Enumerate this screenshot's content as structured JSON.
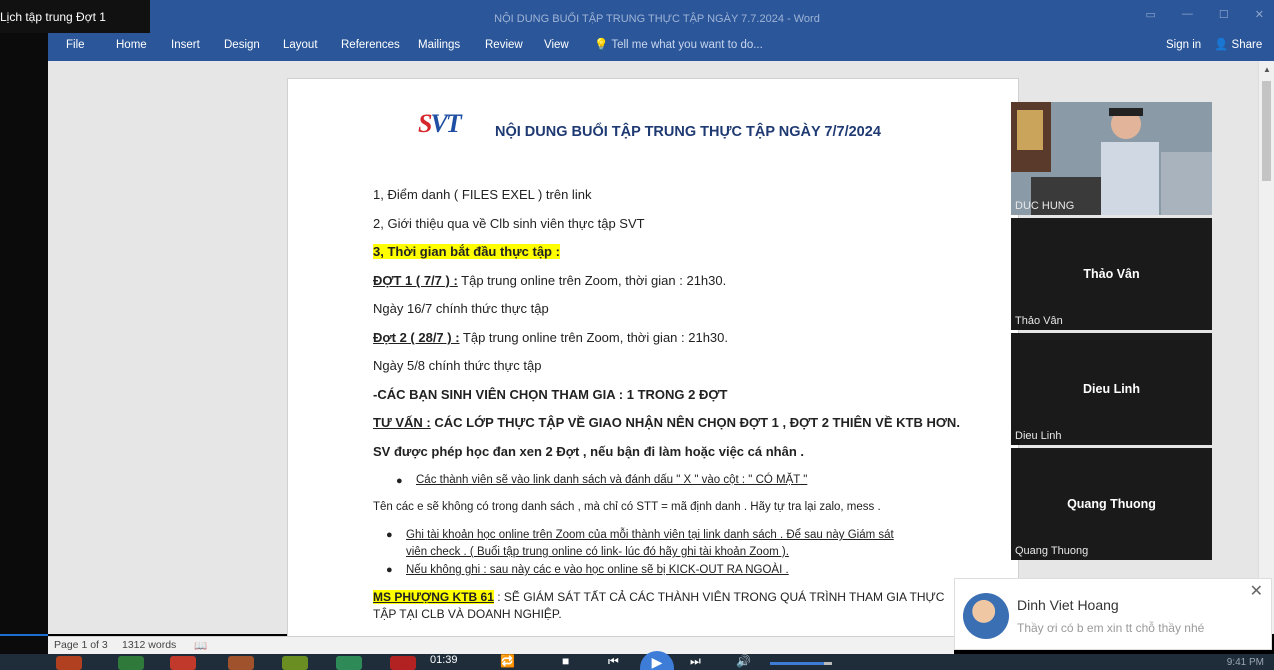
{
  "zoom": {
    "window_title": "Lịch tập trung Đợt 1"
  },
  "word": {
    "window_title": "NỘI DUNG BUỔI  TẬP TRUNG THỰC TẬP NGÀY 7.7.2024 - Word",
    "tabs": [
      "File",
      "Home",
      "Insert",
      "Design",
      "Layout",
      "References",
      "Mailings",
      "Review",
      "View"
    ],
    "tell_me": "Tell me what you want to do...",
    "sign_in": "Sign in",
    "share": "Share"
  },
  "document": {
    "logo": {
      "s": "S",
      "v": "V",
      "t": "T"
    },
    "title": "NỘI DUNG BUỔI  TẬP TRUNG THỰC TẬP NGÀY 7/7/2024",
    "line1": "1, Điểm danh  ( FILES EXEL ) trên link",
    "line2": "2, Giới thiệu qua về Clb sinh viên thực tập SVT",
    "line3": "3, Thời gian bắt đầu thực tập :",
    "dot1_label": "ĐỢT  1  ( 7/7 )   :",
    "dot1_text": " Tập trung online trên Zoom, thời gian : 21h30.",
    "dot1_day": "Ngày  16/7  chính thức thực tập",
    "dot2_label": "Đợt 2   (  28/7 ) :",
    "dot2_text": "  Tập trung online trên Zoom, thời gian : 21h30.",
    "dot2_day": "Ngày  5/8  chính thức thực tập",
    "choose": "-CÁC BẠN SINH VIÊN CHỌN THAM GIA : 1 TRONG 2 ĐỢT",
    "advice_label": "TƯ VẤN :",
    "advice_text": " CÁC LỚP THỰC TẬP VỀ GIAO NHẬN NÊN CHỌN ĐỢT 1 , ĐỢT 2 THIÊN VỀ KTB HƠN.",
    "alternate": "SV được phép học đan xen 2 Đợt , nếu bận đi làm hoặc việc cá nhân .",
    "bullet1": "Các thành viên sẽ vào link danh sách và  đánh dấu \" X \"  vào cột : \" CÓ MẶT \"",
    "not_in_list": "Tên các e sẽ không có  trong danh sách , mà chỉ có STT = mã định danh . Hãy tự tra lại zalo, mess .",
    "bullet2_l1": "Ghi tài khoản học online trên Zoom của mỗi thành viên tại  link danh sách . Để sau này Giám sát",
    "bullet2_l2": "viên check . ( Buổi tập trung online có link- lúc đó hãy ghi tài khoản Zoom ).",
    "bullet3": "Nếu không ghi : sau này các e vào học online sẽ bị   KICK-OUT   RA NGOÀI .",
    "ms_label": "MS  PHƯỢNG  KTB  61",
    "ms_text_l1": " :  SẼ  GIÁM SÁT TẤT CẢ CÁC THÀNH VIÊN TRONG QUÁ TRÌNH THAM GIA THỰC",
    "ms_text_l2": "TẬP TẠI CLB VÀ DOANH NGHIỆP."
  },
  "status_bar": {
    "page": "Page 1 of 3",
    "words": "1312 words"
  },
  "participants": [
    {
      "name": "DUC HUNG"
    },
    {
      "name": "Thảo Vân"
    },
    {
      "name": "Dieu Linh"
    },
    {
      "name": "Quang Thuong"
    }
  ],
  "chat": {
    "sender": "Dinh Viet Hoang",
    "message": "Thầy ơi có b em xin tt chỗ thầy nhé"
  },
  "media": {
    "time": "01:39"
  },
  "clock": "9:41 PM",
  "colors": {
    "word_blue": "#2b579a",
    "highlight": "#ffff00",
    "zoom_bg": "#1a1a1a"
  }
}
